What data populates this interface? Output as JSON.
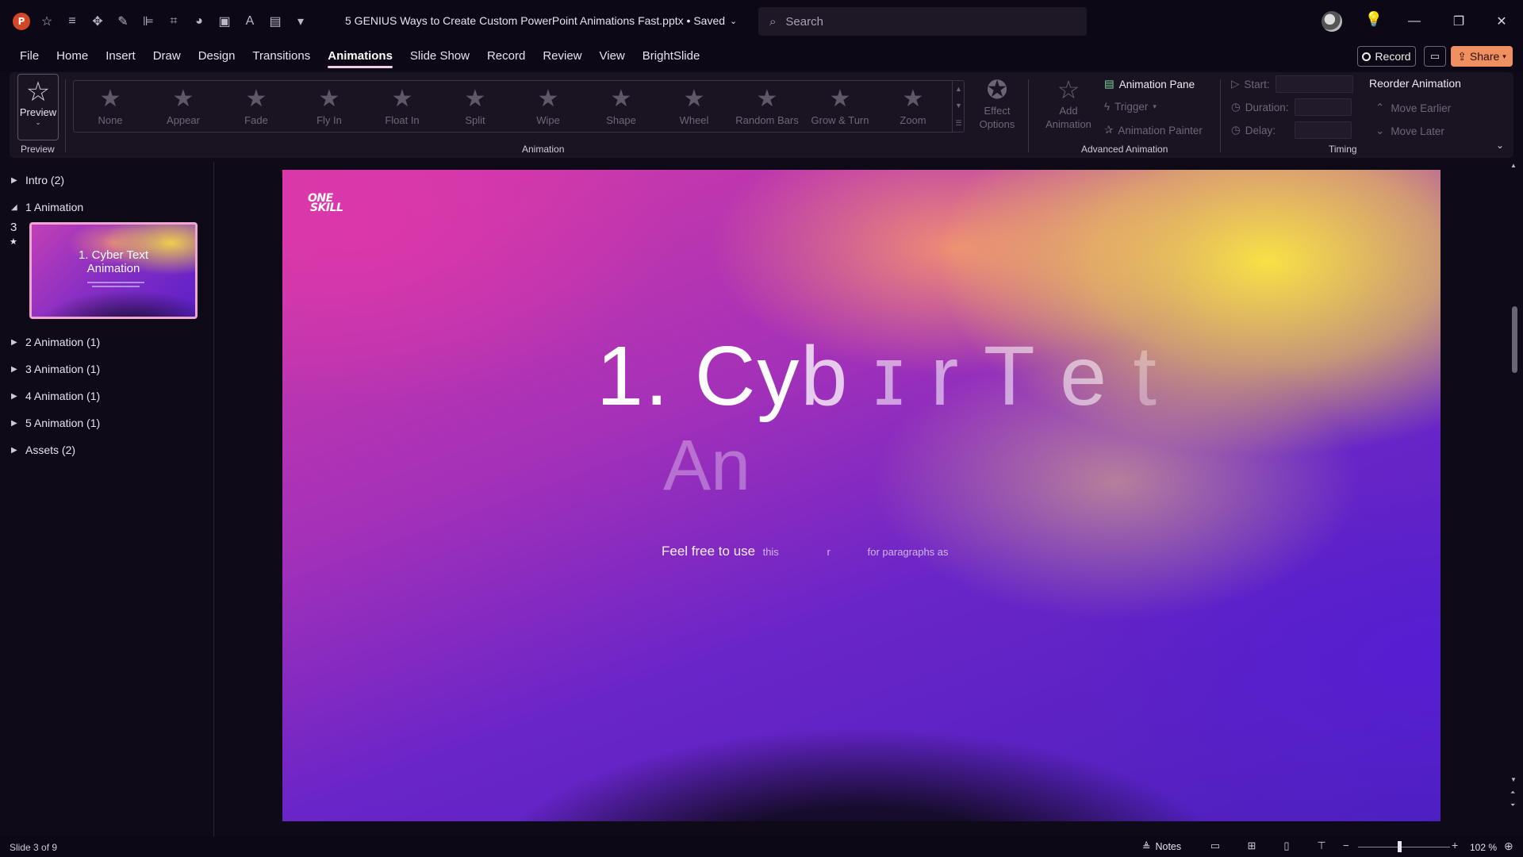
{
  "titlebar": {
    "doc_title": "5 GENIUS Ways to Create Custom PowerPoint Animations Fast.pptx • Saved",
    "search_placeholder": "Search"
  },
  "menu": {
    "tabs": [
      "File",
      "Home",
      "Insert",
      "Draw",
      "Design",
      "Transitions",
      "Animations",
      "Slide Show",
      "Record",
      "Review",
      "View",
      "BrightSlide"
    ],
    "active_tab": "Animations",
    "record_label": "Record",
    "share_label": "Share"
  },
  "ribbon": {
    "preview_label": "Preview",
    "preview_group": "Preview",
    "animation_group": "Animation",
    "gallery": [
      "None",
      "Appear",
      "Fade",
      "Fly In",
      "Float In",
      "Split",
      "Wipe",
      "Shape",
      "Wheel",
      "Random Bars",
      "Grow & Turn",
      "Zoom"
    ],
    "effect_options": "Effect Options",
    "add_animation": "Add Animation",
    "advanced_group": "Advanced Animation",
    "animation_pane": "Animation Pane",
    "trigger": "Trigger",
    "animation_painter": "Animation Painter",
    "timing_group": "Timing",
    "start_label": "Start:",
    "duration_label": "Duration:",
    "delay_label": "Delay:",
    "reorder_title": "Reorder Animation",
    "move_earlier": "Move Earlier",
    "move_later": "Move Later"
  },
  "sidebar": {
    "sections": [
      {
        "label": "Intro (2)",
        "expanded": false
      },
      {
        "label": "1 Animation",
        "expanded": true
      },
      {
        "label": "2 Animation (1)",
        "expanded": false
      },
      {
        "label": "3 Animation (1)",
        "expanded": false
      },
      {
        "label": "4 Animation (1)",
        "expanded": false
      },
      {
        "label": "5 Animation (1)",
        "expanded": false
      },
      {
        "label": "Assets (2)",
        "expanded": false
      }
    ],
    "slide_number": "3",
    "thumb_title_line1": "1. Cyber Text",
    "thumb_title_line2": "Animation"
  },
  "slide": {
    "logo_line1": "ONE",
    "logo_line2": "SKILL",
    "title_solid": "1. Cy",
    "title_b": "b",
    "title_scrambled1": "ɪ r T",
    "title_scrambled2": "e",
    "title_scrambled3": "t",
    "subtitle_ghost": "An",
    "body_solid": "Feel free to use",
    "body_faint1": "this",
    "body_faint2": "r",
    "body_faint3": "for   paragraphs   as"
  },
  "status": {
    "slide_info": "Slide 3 of 9",
    "notes_label": "Notes",
    "zoom": "102 %",
    "zoom_fraction": 0.45
  },
  "colors": {
    "accent_tab_underline": "#f0cfe5",
    "share_button": "#f09060",
    "thumb_border": "#f0a6d4"
  }
}
